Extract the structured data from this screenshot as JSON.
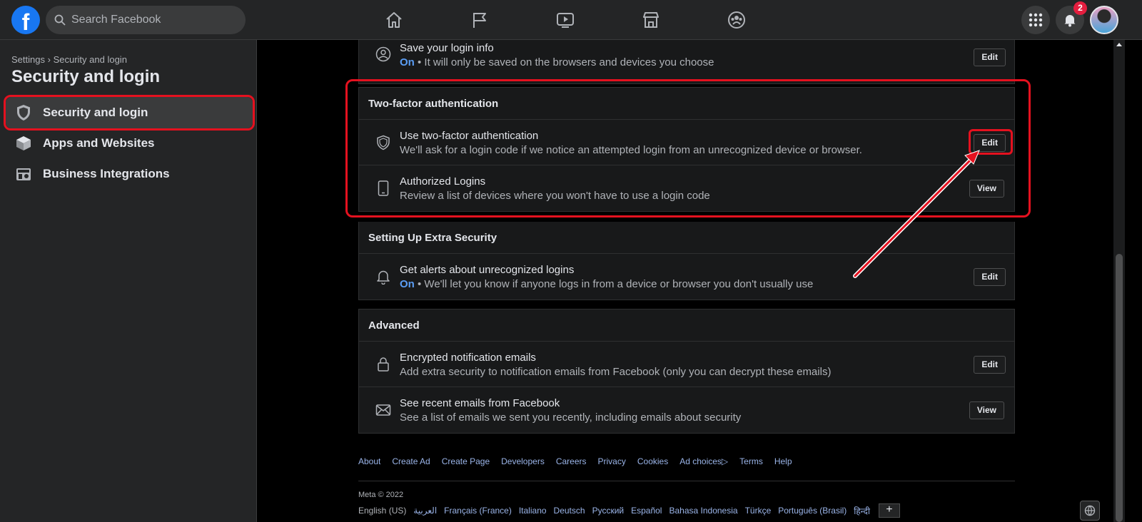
{
  "topbar": {
    "logo_letter": "f",
    "search_placeholder": "Search Facebook",
    "nav_icons": [
      "home-icon",
      "pages-flag-icon",
      "watch-video-icon",
      "marketplace-icon",
      "groups-icon"
    ],
    "menu_icon": "menu-grid-icon",
    "notifications_count": "2"
  },
  "sidebar": {
    "breadcrumb": {
      "root": "Settings",
      "separator": "›",
      "current": "Security and login"
    },
    "title": "Security and login",
    "items": [
      {
        "label": "Security and login",
        "icon": "shield-icon",
        "active": true
      },
      {
        "label": "Apps and Websites",
        "icon": "cube-icon",
        "active": false
      },
      {
        "label": "Business Integrations",
        "icon": "business-icon",
        "active": false
      }
    ]
  },
  "main": {
    "save_login": {
      "title": "Save your login info",
      "status": "On",
      "desc": " • It will only be saved on the browsers and devices you choose",
      "button": "Edit"
    },
    "two_factor": {
      "header": "Two-factor authentication",
      "rows": [
        {
          "title": "Use two-factor authentication",
          "desc": "We'll ask for a login code if we notice an attempted login from an unrecognized device or browser.",
          "button": "Edit",
          "icon": "shield-outline-icon"
        },
        {
          "title": "Authorized Logins",
          "desc": "Review a list of devices where you won't have to use a login code",
          "button": "View",
          "icon": "phone-icon"
        }
      ]
    },
    "extra_security": {
      "header": "Setting Up Extra Security",
      "rows": [
        {
          "title": "Get alerts about unrecognized logins",
          "status": "On",
          "desc": " • We'll let you know if anyone logs in from a device or browser you don't usually use",
          "button": "Edit",
          "icon": "bell-icon"
        }
      ]
    },
    "advanced": {
      "header": "Advanced",
      "rows": [
        {
          "title": "Encrypted notification emails",
          "desc": "Add extra security to notification emails from Facebook (only you can decrypt these emails)",
          "button": "Edit",
          "icon": "lock-icon"
        },
        {
          "title": "See recent emails from Facebook",
          "desc": "See a list of emails we sent you recently, including emails about security",
          "button": "View",
          "icon": "envelope-icon"
        }
      ]
    }
  },
  "footer": {
    "links": [
      "About",
      "Create Ad",
      "Create Page",
      "Developers",
      "Careers",
      "Privacy",
      "Cookies",
      "Ad choices▷",
      "Terms",
      "Help"
    ],
    "copyright": "Meta © 2022",
    "current_language": "English (US)",
    "languages": [
      "العربية",
      "Français (France)",
      "Italiano",
      "Deutsch",
      "Русский",
      "Español",
      "Bahasa Indonesia",
      "Türkçe",
      "Português (Brasil)",
      "हिन्दी"
    ],
    "more_languages_button": "+"
  },
  "colors": {
    "annotation_red": "#e4111f",
    "on_status_blue": "#5b9ef5",
    "fb_blue": "#1877f2",
    "badge_red": "#e41e3f"
  }
}
